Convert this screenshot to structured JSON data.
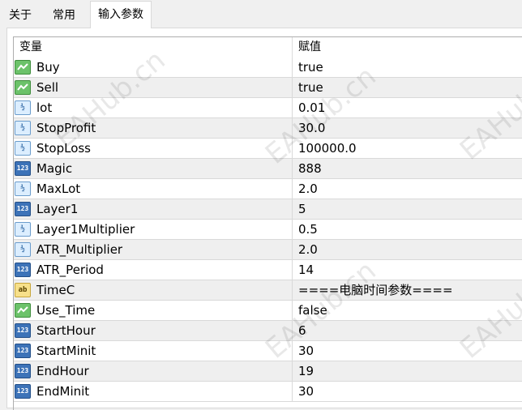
{
  "tabs": [
    {
      "label": "关于",
      "active": false
    },
    {
      "label": "常用",
      "active": false
    },
    {
      "label": "输入参数",
      "active": true
    }
  ],
  "table": {
    "headers": [
      "变量",
      "赋值"
    ],
    "rows": [
      {
        "type": "bool",
        "icon": "bool-type-icon",
        "name": "Buy",
        "value": "true"
      },
      {
        "type": "bool",
        "icon": "bool-type-icon",
        "name": "Sell",
        "value": "true"
      },
      {
        "type": "double",
        "icon": "double-type-icon",
        "name": "lot",
        "value": "0.01"
      },
      {
        "type": "double",
        "icon": "double-type-icon",
        "name": "StopProfit",
        "value": "30.0"
      },
      {
        "type": "double",
        "icon": "double-type-icon",
        "name": "StopLoss",
        "value": "100000.0"
      },
      {
        "type": "int",
        "icon": "int-type-icon",
        "name": "Magic",
        "value": "888"
      },
      {
        "type": "double",
        "icon": "double-type-icon",
        "name": "MaxLot",
        "value": "2.0"
      },
      {
        "type": "int",
        "icon": "int-type-icon",
        "name": "Layer1",
        "value": "5"
      },
      {
        "type": "double",
        "icon": "double-type-icon",
        "name": "Layer1Multiplier",
        "value": "0.5"
      },
      {
        "type": "double",
        "icon": "double-type-icon",
        "name": "ATR_Multiplier",
        "value": "2.0"
      },
      {
        "type": "int",
        "icon": "int-type-icon",
        "name": "ATR_Period",
        "value": "14"
      },
      {
        "type": "string",
        "icon": "string-type-icon",
        "name": "TimeC",
        "value": "====电脑时间参数===="
      },
      {
        "type": "bool",
        "icon": "bool-type-icon",
        "name": "Use_Time",
        "value": "false"
      },
      {
        "type": "int",
        "icon": "int-type-icon",
        "name": "StartHour",
        "value": "6"
      },
      {
        "type": "int",
        "icon": "int-type-icon",
        "name": "StartMinit",
        "value": "30"
      },
      {
        "type": "int",
        "icon": "int-type-icon",
        "name": "EndHour",
        "value": "19"
      },
      {
        "type": "int",
        "icon": "int-type-icon",
        "name": "EndMinit",
        "value": "30"
      }
    ]
  },
  "watermark": "EAHub.cn"
}
